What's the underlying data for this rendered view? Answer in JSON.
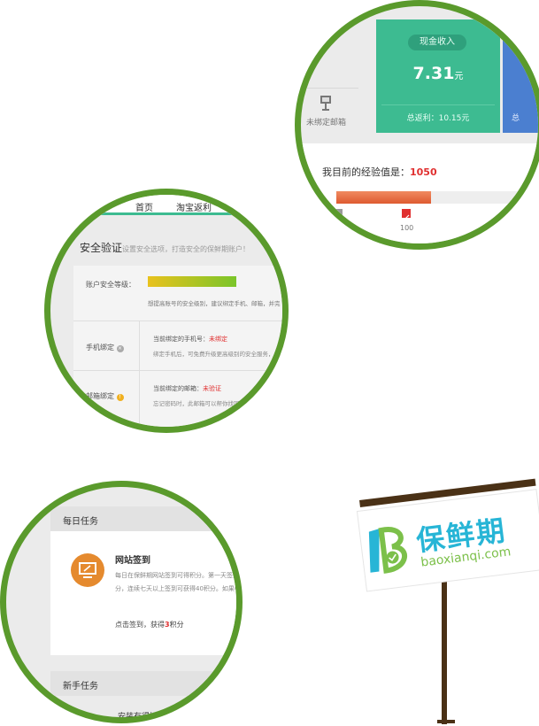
{
  "circle1": {
    "icon_caption": "未绑定邮箱",
    "cash_badge": "现金收入",
    "cash_amount": "7.31",
    "cash_unit": "元",
    "total_rebate": "总返利：10.15元",
    "blue_card_partial": "总",
    "exp_label": "我目前的经验值是：",
    "exp_value": "1050",
    "exp_marker": "100"
  },
  "circle2": {
    "tabs": [
      "首页",
      "淘宝返利"
    ],
    "title": "安全验证",
    "subtitle": "设置安全选项，打造安全的保鲜期账户！",
    "level_label": "账户安全等级：",
    "level_hint": "想提高账号的安全级别，建议绑定手机、邮箱，并完",
    "phone_label": "手机绑定",
    "phone_status_prefix": "当前绑定的手机号：",
    "phone_status": "未绑定",
    "phone_desc": "绑定手机后，可免费升级更高级别的安全服务，",
    "email_label": "邮箱绑定",
    "email_status_prefix": "当前绑定的邮箱：",
    "email_status": "未验证",
    "email_desc": "忘记密码时，此邮箱可以帮你找回密码"
  },
  "circle3": {
    "daily_header": "每日任务",
    "task_title": "网站签到",
    "task_desc1": "每日在保鲜期网站签到可得积分。第一天签到",
    "task_desc2": "分，连续七天以上签到可获得40积分。如果中",
    "signin_prefix": "点击签到，获得",
    "signin_points": "3",
    "signin_suffix": "积分",
    "newbie_header": "新手任务",
    "newbie_partial": "安装有得插"
  },
  "sign": {
    "brand_cn": "保鲜期",
    "brand_url": "baoxianqi.com"
  },
  "colors": {
    "ring": "#5a9a2c",
    "green": "#3dbb91",
    "blue": "#4b7fd0",
    "red": "#e03030",
    "orange": "#e58a2e",
    "brand_cyan": "#27b5d6",
    "brand_green": "#7cc04a"
  }
}
